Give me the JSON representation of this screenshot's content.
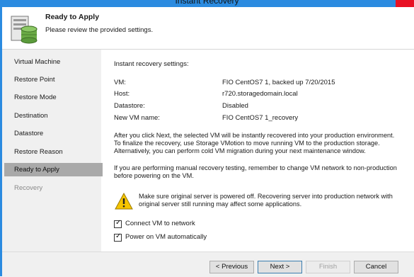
{
  "window": {
    "title": "Instant Recovery"
  },
  "header": {
    "title": "Ready to Apply",
    "subtitle": "Please review the provided  settings."
  },
  "sidebar": {
    "items": [
      {
        "label": "Virtual Machine"
      },
      {
        "label": "Restore Point"
      },
      {
        "label": "Restore Mode"
      },
      {
        "label": "Destination"
      },
      {
        "label": "Datastore"
      },
      {
        "label": "Restore Reason"
      },
      {
        "label": "Ready to Apply"
      },
      {
        "label": "Recovery"
      }
    ],
    "active_index": 6
  },
  "settings": {
    "heading": "Instant recovery settings:",
    "rows": [
      {
        "key": "VM:",
        "value": "FIO CentOS7 1, backed up 7/20/2015"
      },
      {
        "key": "Host:",
        "value": "r720.storagedomain.local"
      },
      {
        "key": "Datastore:",
        "value": "Disabled"
      },
      {
        "key": "New VM name:",
        "value": "FIO CentOS7 1_recovery"
      }
    ]
  },
  "info": {
    "line1": "After you click Next, the selected VM will be instantly recovered into your production environment.",
    "line2": "To finalize the recovery, use Storage VMotion to move running VM to the production storage.",
    "line3": "Alternatively, you can perform cold VM migration during your next maintenance window.",
    "line4": "If you are performing manual recovery testing, remember to change VM network to non-production",
    "line5": "before powering on the VM."
  },
  "warning": {
    "line1": "Make sure original server is powered off. Recovering server into production network with",
    "line2": "original server still running may affect some applications."
  },
  "options": [
    {
      "label": "Connect VM to network",
      "checked": true
    },
    {
      "label": "Power on VM automatically",
      "checked": true
    }
  ],
  "buttons": {
    "previous": "< Previous",
    "next": "Next >",
    "finish": "Finish",
    "cancel": "Cancel"
  },
  "colors": {
    "accent": "#2b8be0",
    "close": "#e81123",
    "active_step": "#a9a9a9"
  }
}
